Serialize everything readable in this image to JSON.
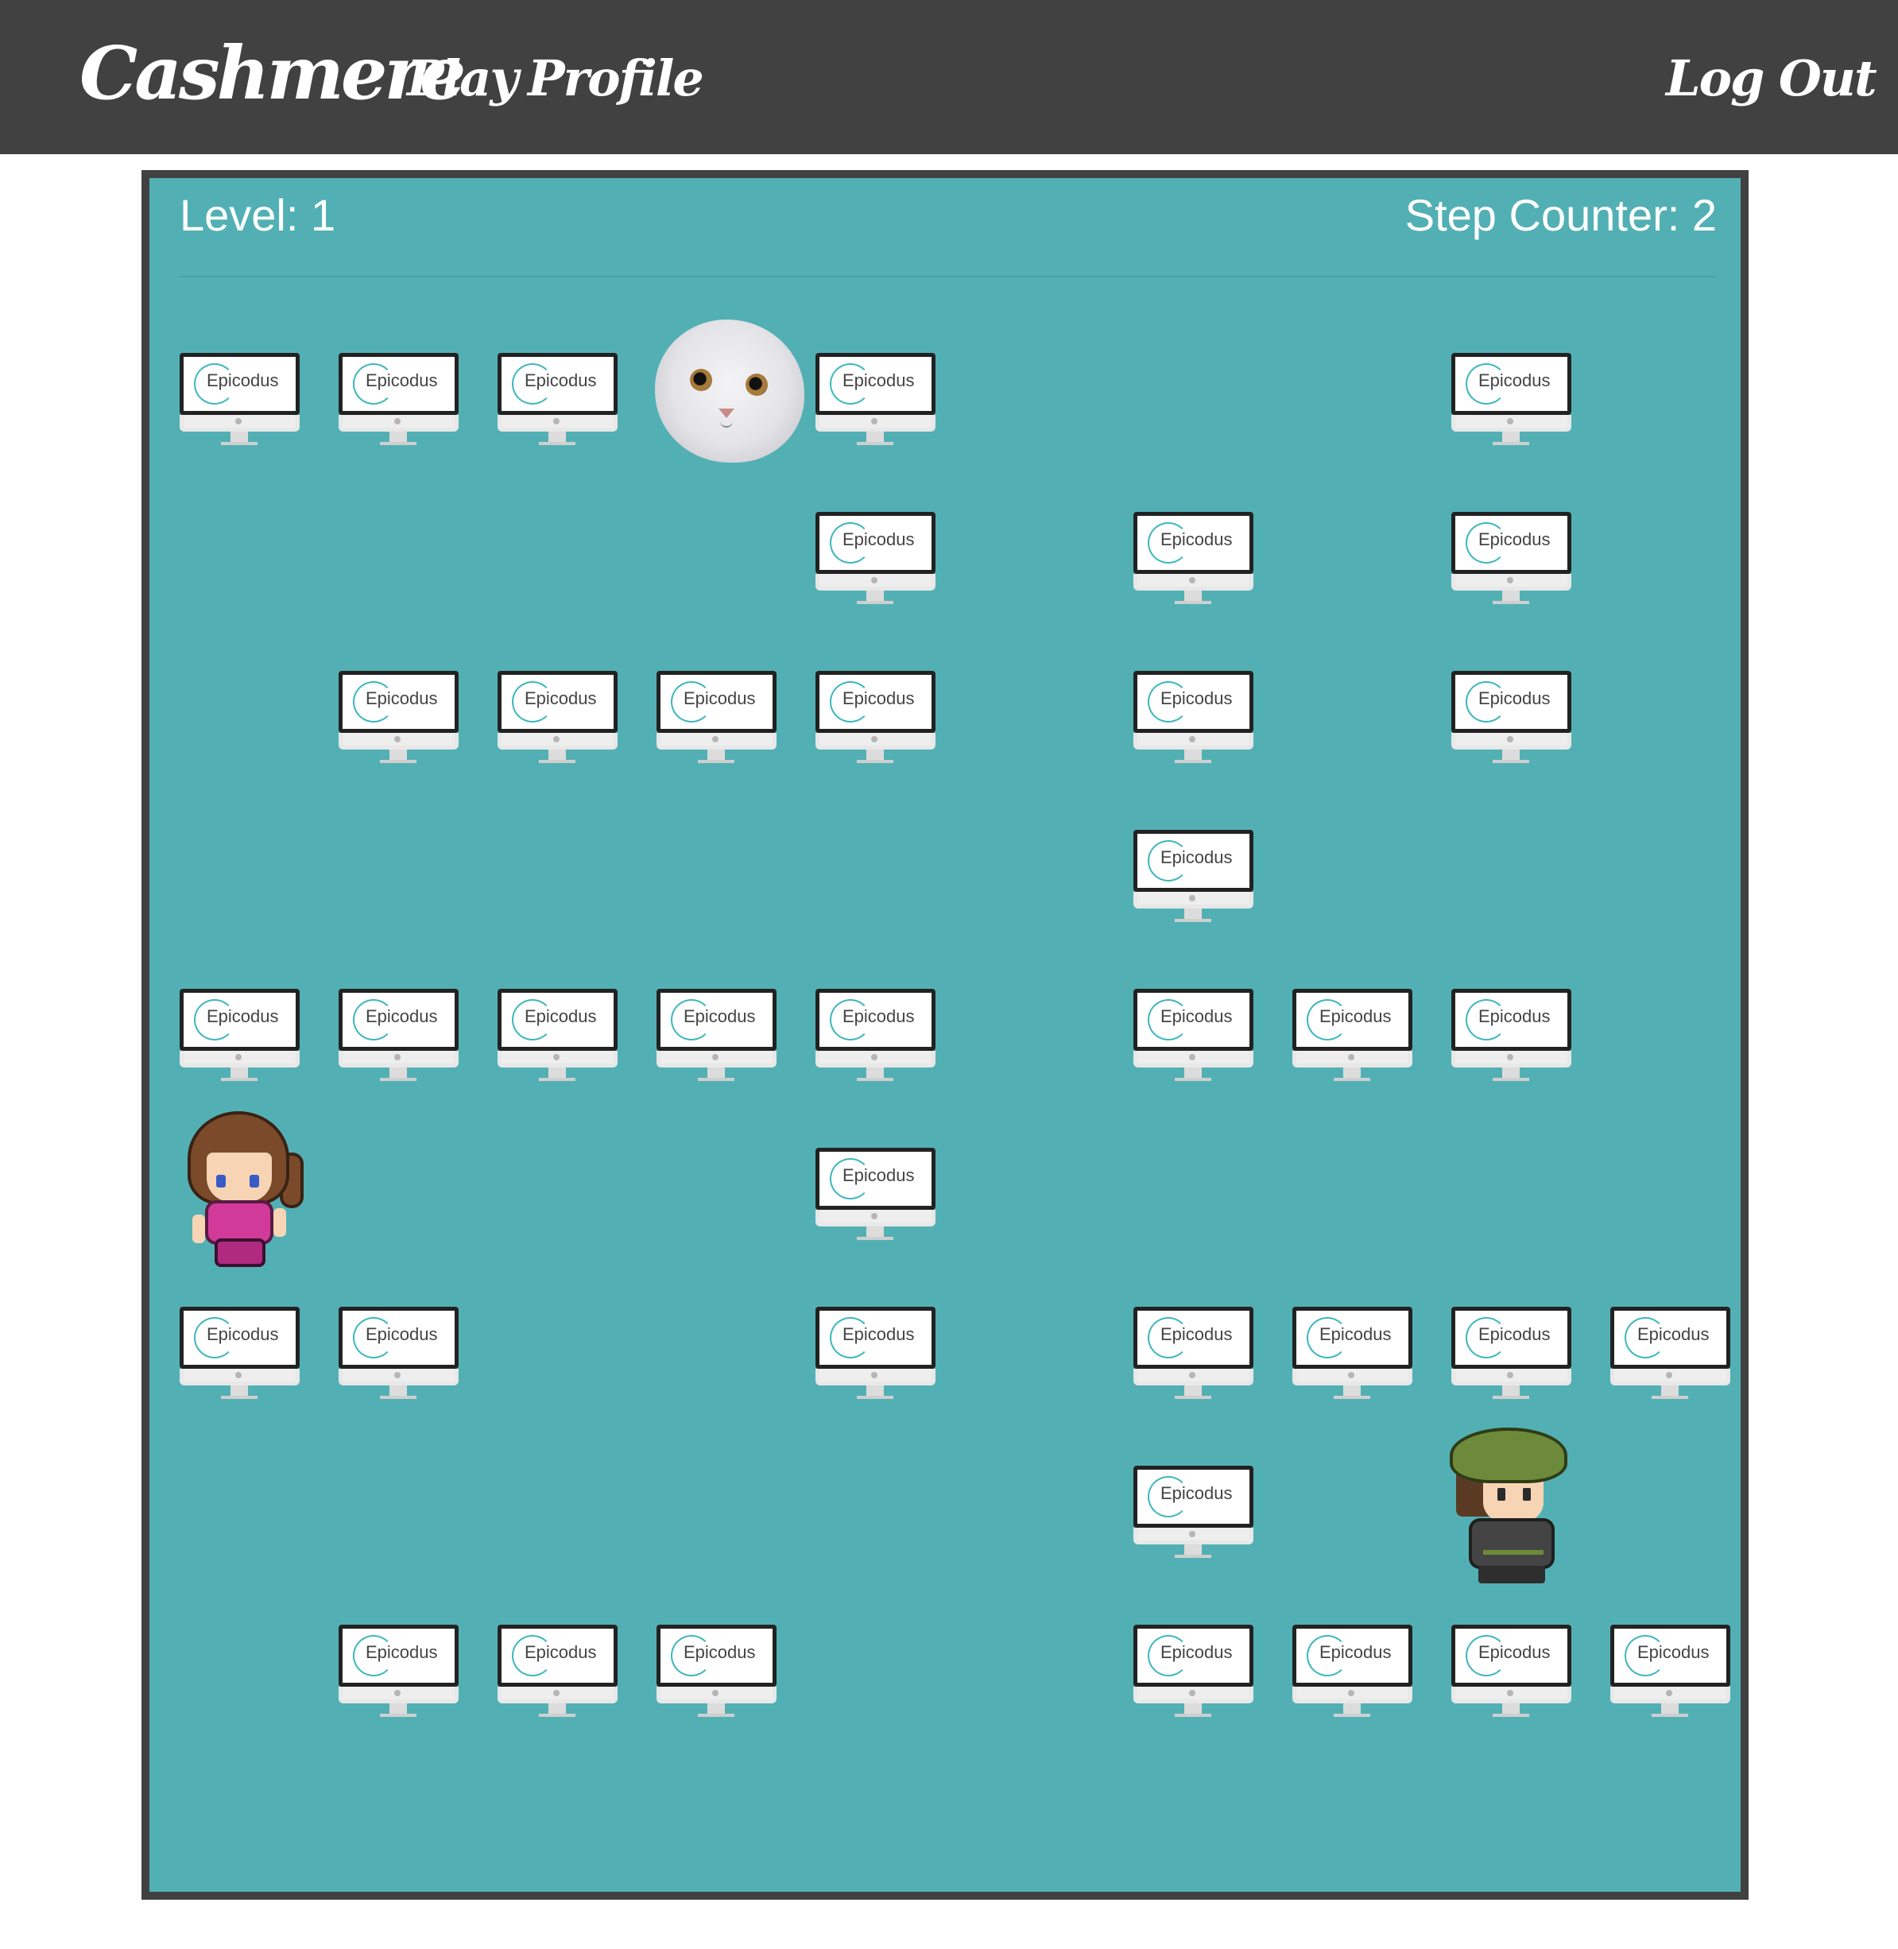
{
  "nav": {
    "brand": "Cashmere",
    "play": "Play",
    "profile": "Profile",
    "logout": "Log Out"
  },
  "hud": {
    "level_label": "Level: 1",
    "steps_label": "Step Counter: 2"
  },
  "board": {
    "background_color": "#52b0b5",
    "border_color": "#414141",
    "obstacle_label": "Epicodus",
    "grid_legend": {
      "#": "epicodus-computer",
      "C": "cat",
      "P": "player",
      "E": "enemy",
      ".": "empty"
    },
    "rows": [
      "###C#...#.",
      "....#.#.#.",
      ".####.#.#.",
      "......#...",
      "#####.###.",
      "P...#.....",
      "##..#.####",
      "......#.E.",
      ".###..####",
      ".........."
    ]
  }
}
